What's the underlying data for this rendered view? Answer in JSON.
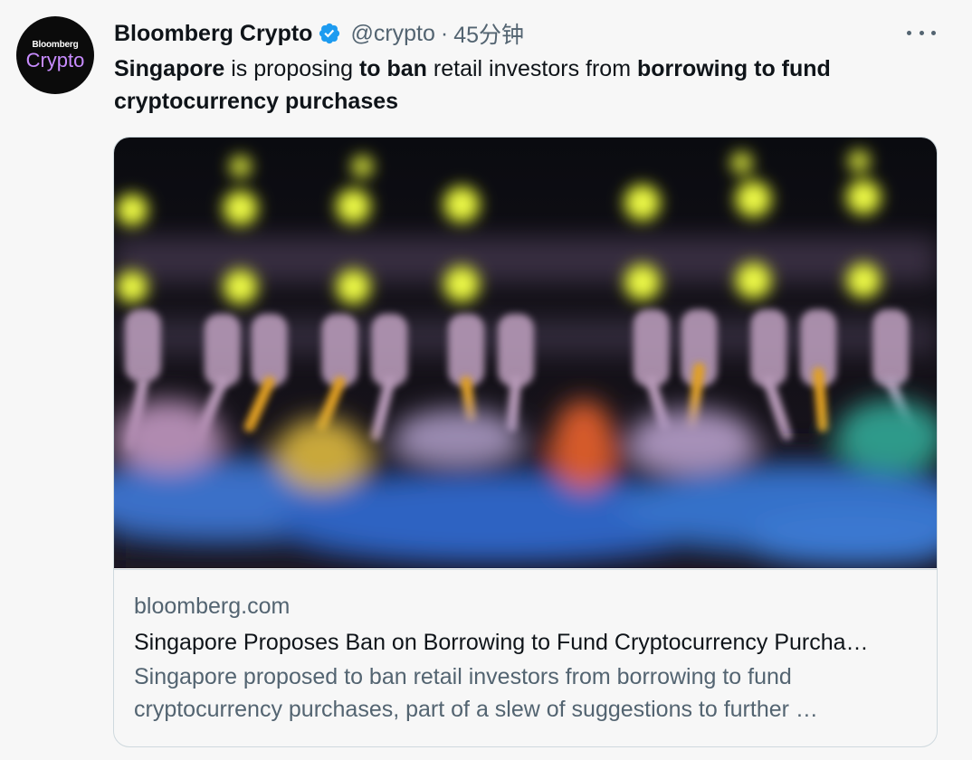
{
  "account": {
    "avatar_line1": "Bloomberg",
    "avatar_line2": "Crypto",
    "name": "Bloomberg Crypto",
    "handle": "@crypto",
    "separator": "·",
    "time": "45分钟",
    "verified_icon": "verified-badge-icon"
  },
  "tweet": {
    "text_parts": [
      "Singapore",
      " is proposing ",
      "to ban",
      " retail investors from ",
      "borrowing to fund cryptocurrency purchases"
    ]
  },
  "card": {
    "image_alt": "Blurred fiber optic cables with glowing yellow lights",
    "domain": "bloomberg.com",
    "title": "Singapore Proposes Ban on Borrowing to Fund Cryptocurrency Purcha…",
    "description": "Singapore proposed to ban retail investors from borrowing to fund cryptocurrency purchases, part of a slew of suggestions to further …"
  },
  "colors": {
    "text_primary": "#0f1419",
    "text_secondary": "#536471",
    "verified_blue": "#1d9bf0",
    "border": "#cfd9de",
    "background": "#f7f7f7"
  }
}
